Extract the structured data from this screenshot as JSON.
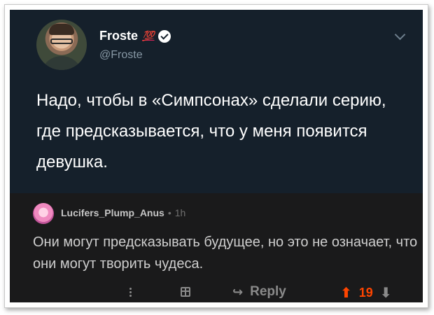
{
  "tweet": {
    "name": "Froste",
    "badge": "💯",
    "handle": "@Froste",
    "text": "Надо, чтобы в «Симпсонах» сделали серию, где предсказывается, что у меня появится девушка.",
    "background": "#15202b"
  },
  "reply": {
    "username": "Lucifers_Plump_Anus",
    "separator": "•",
    "time": "1h",
    "text": "Они могут предсказывать будущее, но это не означает, что они могут творить чудеса.",
    "reply_label": "Reply",
    "score": "19",
    "background": "#1a1a1b",
    "upvote_color": "#ff4500"
  },
  "icons": {
    "upvote": "⬆",
    "downvote": "⬇",
    "reply_arrow": "↩"
  }
}
